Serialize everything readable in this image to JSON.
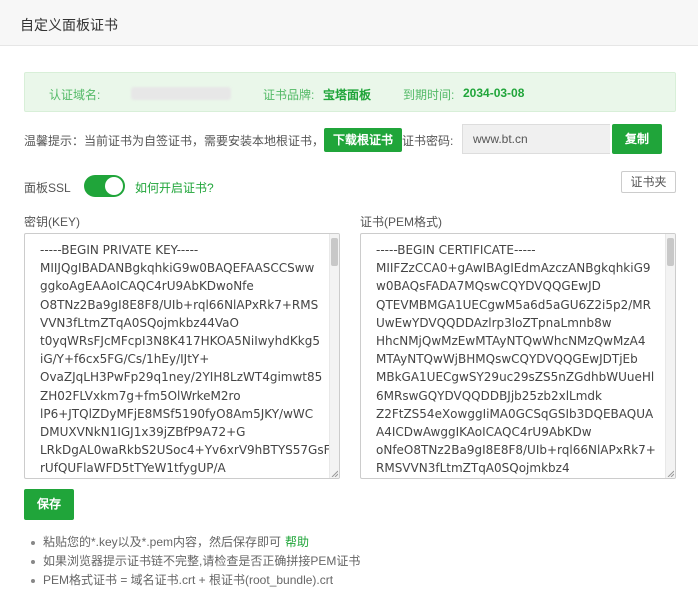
{
  "dialog": {
    "title": "自定义面板证书"
  },
  "cert_info": {
    "domain_label": "认证域名:",
    "brand_label": "证书品牌:",
    "brand_value": "宝塔面板",
    "expire_label": "到期时间:",
    "expire_value": "2034-03-08"
  },
  "tip": {
    "text": "温馨提示：当前证书为自签证书，需要安装本地根证书，",
    "download_button": "下载根证书",
    "password_label": "证书密码:",
    "password_value": "www.bt.cn",
    "copy_button": "复制"
  },
  "ssl": {
    "label": "面板SSL",
    "enabled": true,
    "how_link": "如何开启证书?",
    "folder_button": "证书夹"
  },
  "key_field": {
    "label": "密钥(KEY)",
    "lines": [
      "-----BEGIN PRIVATE KEY-----",
      "MIIJQgIBADANBgkqhkiG9w0BAQEFAASCCSww",
      "ggkoAgEAAoICAQC4rU9AbKDwoNfe",
      "O8TNz2Ba9gI8E8F8/UIb+rql66NlAPxRk7+RMS",
      "VVN3fLtmZTqA0SQojmkbz44VaO",
      "t0yqWRsFJcMFcpI3N8K417HKOA5NiIwyhdKkg5",
      "iG/Y+f6cx5FG/Cs/1hEy/IJtY+",
      "OvaZJqLH3PwFp29q1ney/2YIH8LzWT4gimwt85",
      "ZH02FLVxkm7g+fm5OlWrkeM2ro",
      "lP6+JTQlZDyMFjE8MSf5190fyO8Am5JKY/wWC",
      "DMUXVNkN1IGJ1x39jZBfP9A72+G",
      "LRkDgAL0waRkbS2USoc4+Yv6xrV9hBTYS57GsF",
      "rUfQUFlaWFD5tTYeW1tfygUP/A"
    ]
  },
  "cert_field": {
    "label": "证书(PEM格式)",
    "lines": [
      "-----BEGIN CERTIFICATE-----",
      "MIIFZzCCA0+gAwIBAgIEdmAzczANBgkqhkiG9",
      "w0BAQsFADA7MQswCQYDVQQGEwJD",
      "QTEVMBMGA1UECgwM5a6d5aGU6Z2i5p2/MR",
      "UwEwYDVQQDDAzlrp3loZTpnaLmnb8w",
      "HhcNMjQwMzEwMTAyNTQwWhcNMzQwMzA4",
      "MTAyNTQwWjBHMQswCQYDVQQGEwJDTjEb",
      "MBkGA1UECgwSY29uc29sZS5nZGdhbWUueHl",
      "6MRswGQYDVQQDDBJjb25zb2xlLmdk",
      "Z2FtZS54eXowggIiMA0GCSqGSIb3DQEBAQUA",
      "A4ICDwAwggIKAoICAQC4rU9AbKDw",
      "oNfeO8TNz2Ba9gI8E8F8/UIb+rql66NlAPxRk7+",
      "RMSVVN3fLtmZTqA0SQojmkbz4"
    ]
  },
  "save_button": "保存",
  "notes": [
    {
      "text": "粘贴您的*.key以及*.pem内容，然后保存即可",
      "link": "帮助"
    },
    {
      "text": "如果浏览器提示证书链不完整,请检查是否正确拼接PEM证书"
    },
    {
      "text": "PEM格式证书 = 域名证书.crt + 根证书(root_bundle).crt"
    }
  ],
  "colors": {
    "accent": "#20a53a",
    "info_bg": "#eaf7ea"
  }
}
